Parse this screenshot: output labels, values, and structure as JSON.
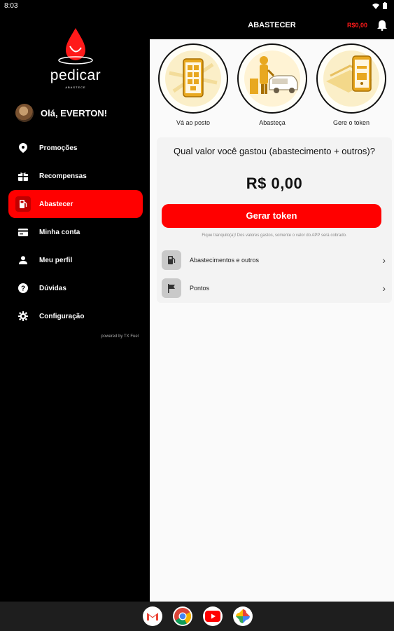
{
  "status_bar": {
    "time": "8:03"
  },
  "drawer": {
    "logo_text": "pedicar",
    "logo_sub": "ABASTECE",
    "greeting": "Olá, EVERTON!",
    "items": [
      {
        "label": "Promoções",
        "icon": "location-pin-icon"
      },
      {
        "label": "Recompensas",
        "icon": "gift-icon"
      },
      {
        "label": "Abastecer",
        "icon": "fuel-pump-icon",
        "active": true
      },
      {
        "label": "Minha conta",
        "icon": "credit-card-icon"
      },
      {
        "label": "Meu perfil",
        "icon": "person-icon"
      },
      {
        "label": "Dúvidas",
        "icon": "help-circle-icon"
      },
      {
        "label": "Configuração",
        "icon": "gear-icon"
      }
    ],
    "powered_by": "powered by TX Fuel"
  },
  "topbar": {
    "title": "ABASTECER",
    "price": "R$0,00"
  },
  "steps": [
    {
      "caption": "Vá ao posto"
    },
    {
      "caption": "Abasteça"
    },
    {
      "caption": "Gere o token"
    }
  ],
  "card": {
    "question": "Qual valor você gastou (abastecimento + outros)?",
    "amount": "R$ 0,00",
    "button": "Gerar token",
    "note": "Fique tranquilo(a)! Dos valores gastos, somente o valor do APP será cobrado.",
    "rows": [
      {
        "label": "Abastecimentos e outros"
      },
      {
        "label": "Pontos"
      }
    ]
  },
  "colors": {
    "accent": "#ff0000",
    "drawer_bg": "#000000",
    "content_bg": "#fafafa"
  },
  "dock_apps": [
    "Gmail",
    "Chrome",
    "YouTube",
    "Photos"
  ]
}
